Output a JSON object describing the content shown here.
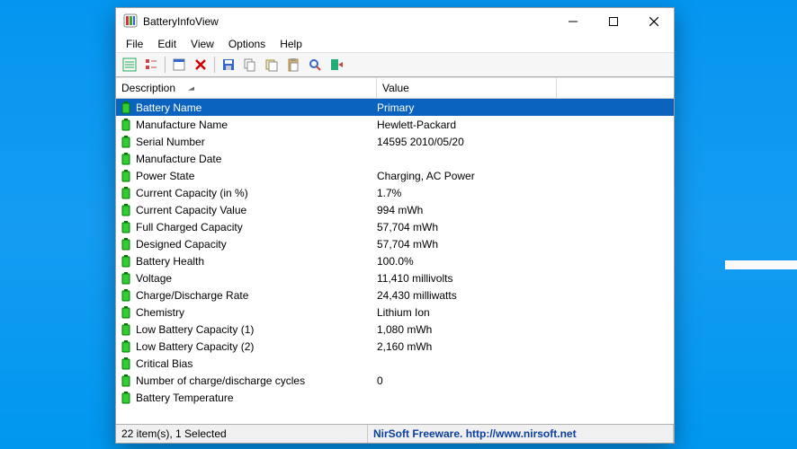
{
  "window": {
    "title": "BatteryInfoView"
  },
  "menu": {
    "items": [
      "File",
      "Edit",
      "View",
      "Options",
      "Help"
    ]
  },
  "toolbar_icons": [
    "view-details-icon",
    "view-list-icon",
    "sep",
    "properties-icon",
    "delete-icon",
    "sep",
    "save-icon",
    "copy-icon",
    "copy-row-icon",
    "paste-icon",
    "find-icon",
    "exit-icon"
  ],
  "columns": {
    "description": "Description",
    "value": "Value"
  },
  "rows": [
    {
      "desc": "Battery Name",
      "val": "Primary",
      "selected": true
    },
    {
      "desc": "Manufacture Name",
      "val": "Hewlett-Packard"
    },
    {
      "desc": "Serial Number",
      "val": "14595 2010/05/20"
    },
    {
      "desc": "Manufacture Date",
      "val": ""
    },
    {
      "desc": "Power State",
      "val": "Charging, AC Power"
    },
    {
      "desc": "Current Capacity (in %)",
      "val": "1.7%"
    },
    {
      "desc": "Current Capacity Value",
      "val": "994 mWh"
    },
    {
      "desc": "Full Charged Capacity",
      "val": "57,704 mWh"
    },
    {
      "desc": "Designed Capacity",
      "val": "57,704 mWh"
    },
    {
      "desc": "Battery Health",
      "val": "100.0%"
    },
    {
      "desc": "Voltage",
      "val": "11,410 millivolts"
    },
    {
      "desc": "Charge/Discharge Rate",
      "val": "24,430 milliwatts"
    },
    {
      "desc": "Chemistry",
      "val": "Lithium Ion"
    },
    {
      "desc": "Low Battery Capacity (1)",
      "val": "1,080 mWh"
    },
    {
      "desc": "Low Battery Capacity (2)",
      "val": "2,160 mWh"
    },
    {
      "desc": "Critical Bias",
      "val": ""
    },
    {
      "desc": "Number of charge/discharge cycles",
      "val": "0"
    },
    {
      "desc": "Battery Temperature",
      "val": ""
    }
  ],
  "status": {
    "count": "22 item(s), 1 Selected",
    "credit": "NirSoft Freeware.  http://www.nirsoft.net"
  }
}
